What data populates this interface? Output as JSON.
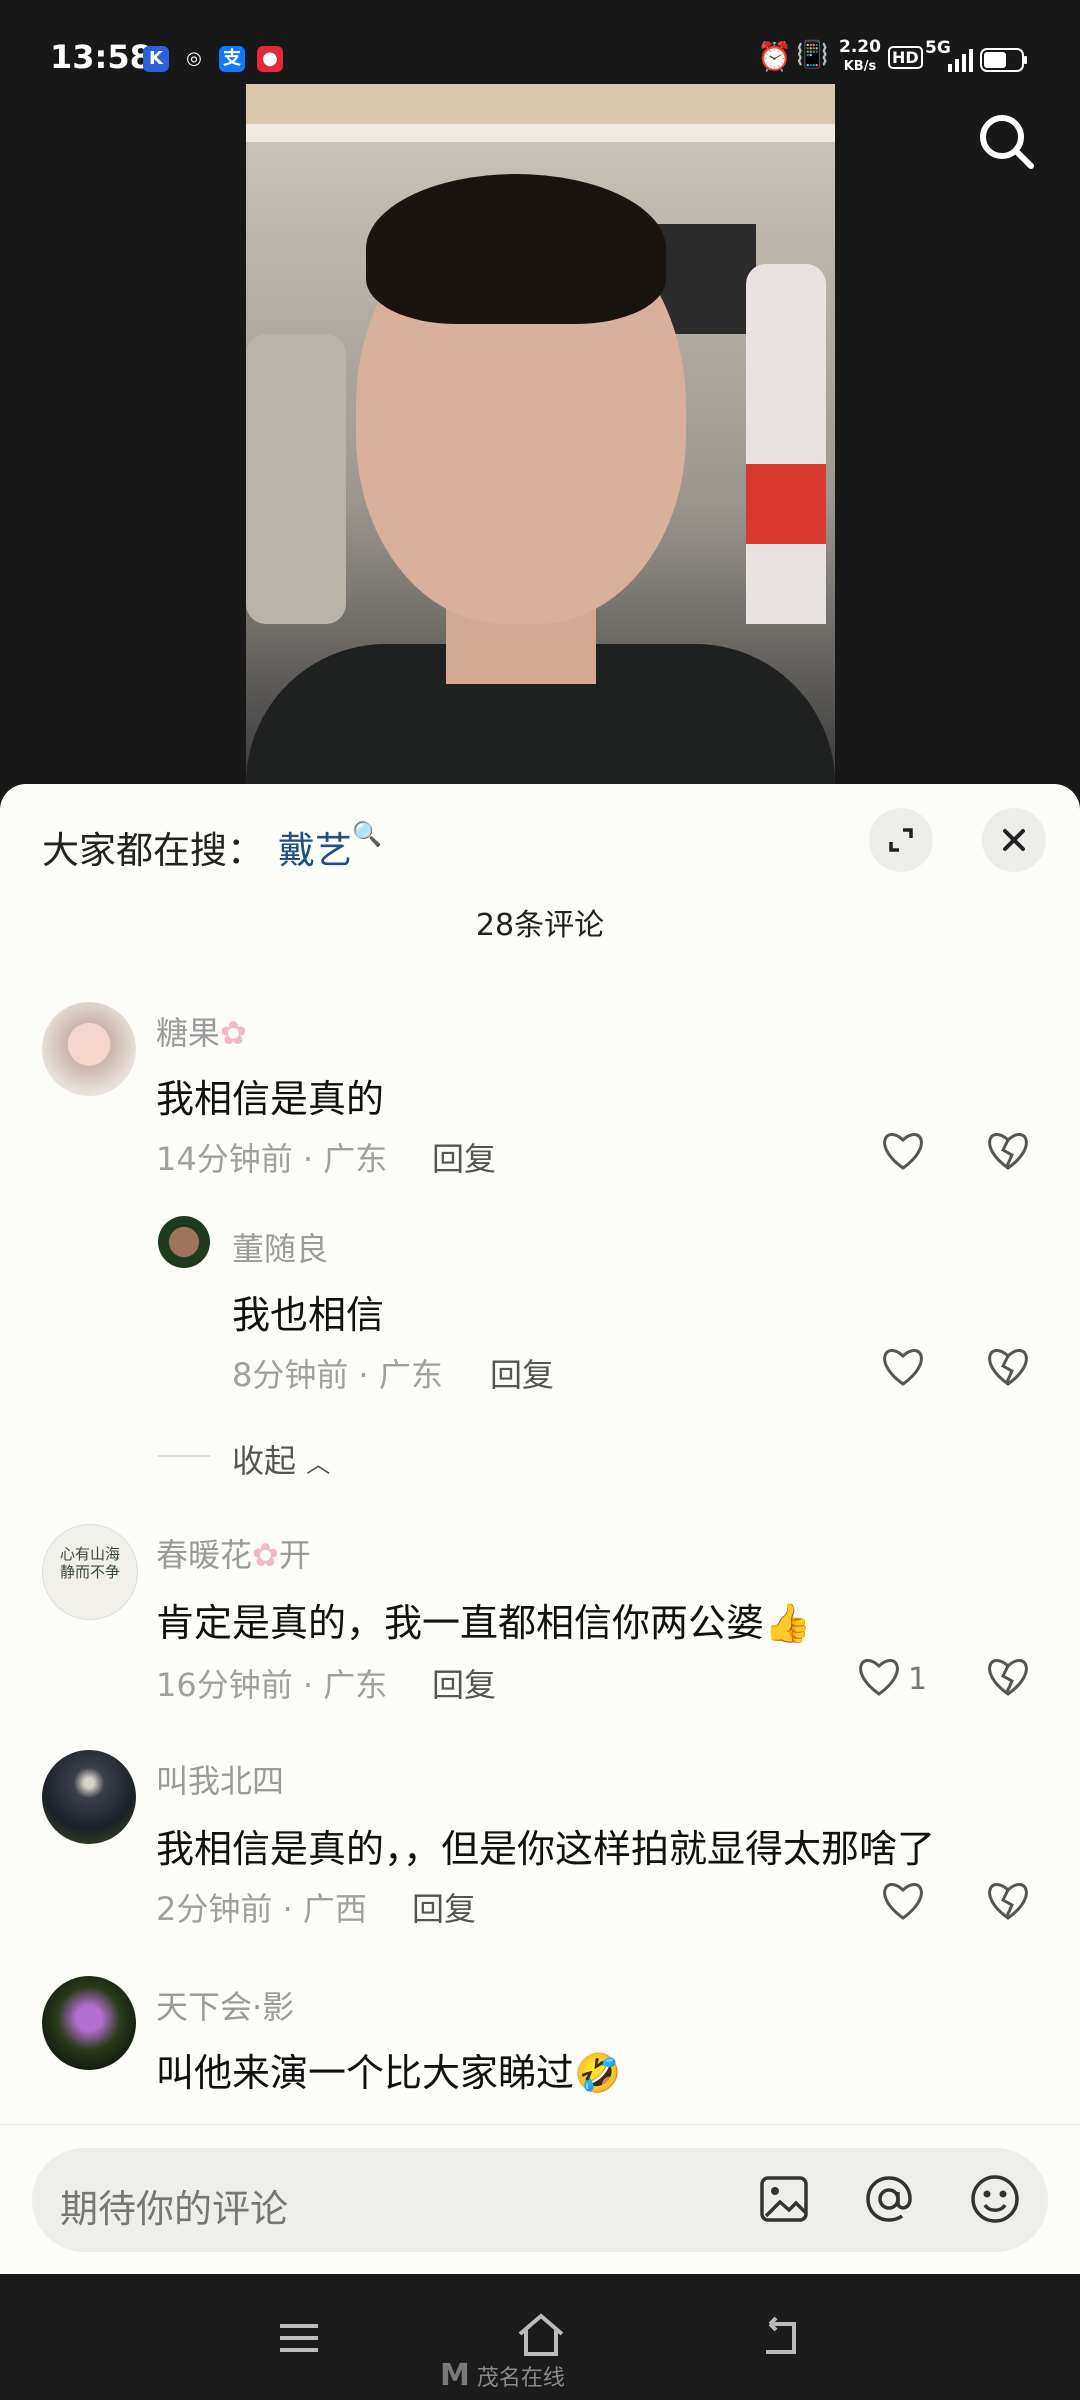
{
  "status_bar": {
    "time": "13:58",
    "net_speed": "2.20",
    "net_unit": "KB/s",
    "hd": "HD",
    "signal": "5G"
  },
  "trending": {
    "label": "大家都在搜：",
    "term": "戴艺"
  },
  "comment_count": "28条评论",
  "comments": [
    {
      "user": "糖果",
      "text": "我相信是真的",
      "meta": "14分钟前 · 广东",
      "reply_label": "回复",
      "likes": ""
    },
    {
      "user": "董随良",
      "text": "我也相信",
      "meta": "8分钟前 · 广东",
      "reply_label": "回复",
      "likes": ""
    },
    {
      "user": "春暖花",
      "user_suffix": "开",
      "text": "肯定是真的，我一直都相信你两公婆",
      "meta": "16分钟前 · 广东",
      "reply_label": "回复",
      "likes": "1"
    },
    {
      "user": "叫我北四",
      "text": "我相信是真的，，但是你这样拍就显得太那啥了",
      "meta": "2分钟前 · 广西",
      "reply_label": "回复",
      "likes": ""
    },
    {
      "user": "天下会·影",
      "text": "叫他来演一个比大家睇过",
      "meta": "",
      "reply_label": "",
      "likes": ""
    }
  ],
  "collapse_label": "收起",
  "avatar_text": {
    "spring_avatar_calligraphy": "心有山海 静而不争"
  },
  "composer": {
    "placeholder": "期待你的评论"
  },
  "watermark": "茂名在线",
  "icons": [
    "search-icon",
    "expand-icon",
    "close-icon",
    "heart-icon",
    "broken-heart-icon",
    "image-icon",
    "at-icon",
    "emoji-icon",
    "menu-icon",
    "home-icon",
    "back-icon"
  ],
  "colors": {
    "link": "#1f4f86",
    "sheet_bg": "#fcfcf8"
  }
}
